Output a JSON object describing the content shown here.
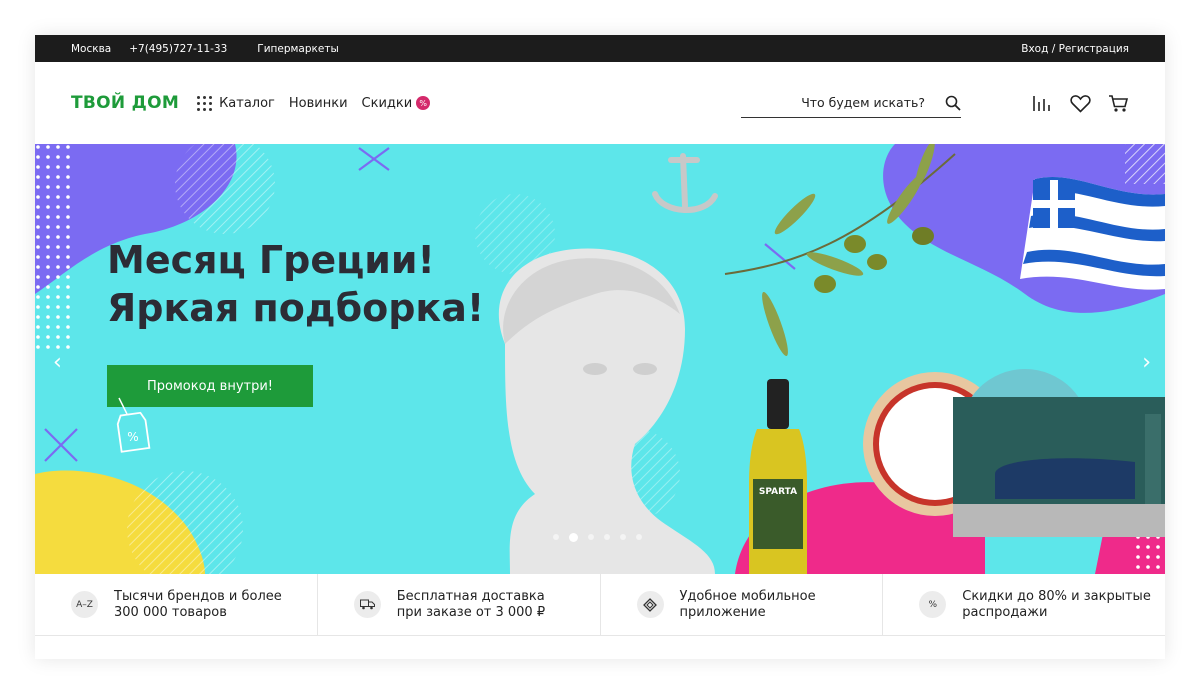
{
  "topbar": {
    "city": "Москва",
    "phone": "+7(495)727-11-33",
    "hypermarkets": "Гипермаркеты",
    "auth": "Вход / Регистрация"
  },
  "header": {
    "logo": "ТВОЙ ДОМ",
    "nav": {
      "catalog": "Каталог",
      "new": "Новинки",
      "sales": "Скидки",
      "sales_badge": "%"
    },
    "search": {
      "placeholder": "Что будем искать?"
    },
    "icons": [
      "compare-icon",
      "heart-icon",
      "cart-icon"
    ]
  },
  "hero": {
    "title_line1": "Месяц Греции!",
    "title_line2": "Яркая подборка!",
    "promo_button": "Промокод внутри!",
    "tag_symbol": "%",
    "bottle_label": "SPARTA",
    "slides": {
      "count": 6,
      "active": 2
    }
  },
  "features": [
    {
      "icon": "A–Z",
      "text": "Тысячи брендов и более\n300 000 товаров"
    },
    {
      "icon": "truck-icon",
      "text": "Бесплатная доставка\nпри заказе от 3 000 ₽"
    },
    {
      "icon": "app-icon",
      "text": "Удобное мобильное\nприложение"
    },
    {
      "icon": "%",
      "text": "Скидки до 80% и закрытые\nраспродажи"
    }
  ],
  "colors": {
    "brand": "#1e9b3a",
    "hero_bg": "#5de6ea",
    "purple": "#7b6bf2",
    "pink": "#ef2a8a",
    "yellow": "#f5dc3e"
  }
}
